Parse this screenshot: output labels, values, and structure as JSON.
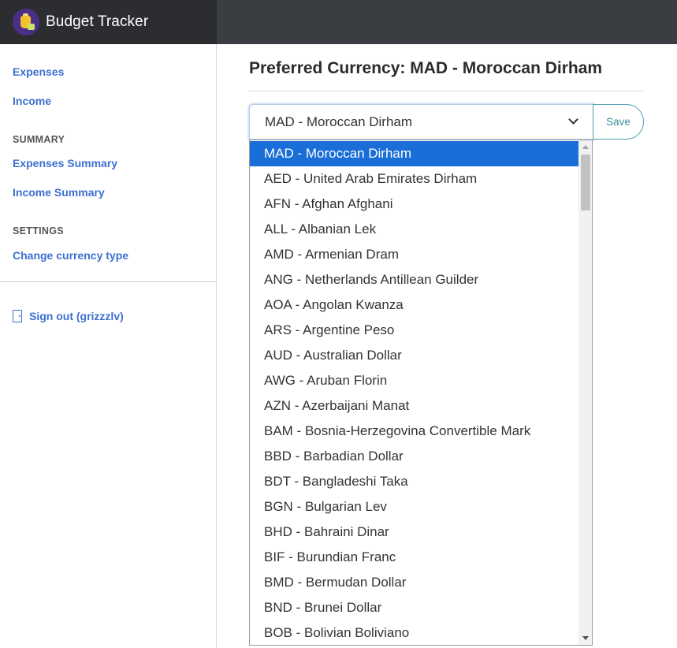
{
  "app": {
    "title": "Budget Tracker",
    "logo_icon": "money-bag-icon"
  },
  "sidebar": {
    "links": [
      {
        "label": "Expenses"
      },
      {
        "label": "Income"
      }
    ],
    "summary_heading": "SUMMARY",
    "summary_links": [
      {
        "label": "Expenses Summary"
      },
      {
        "label": "Income Summary"
      }
    ],
    "settings_heading": "SETTINGS",
    "settings_links": [
      {
        "label": "Change currency type"
      }
    ],
    "signout_label": "Sign out (grizzzlv)",
    "signout_icon": "door-icon"
  },
  "main": {
    "title": "Preferred Currency: MAD - Moroccan Dirham",
    "select_value": "MAD - Moroccan Dirham",
    "save_label": "Save"
  },
  "dropdown": {
    "selected_index": 0,
    "options": [
      "MAD - Moroccan Dirham",
      "AED - United Arab Emirates Dirham",
      "AFN - Afghan Afghani",
      "ALL - Albanian Lek",
      "AMD - Armenian Dram",
      "ANG - Netherlands Antillean Guilder",
      "AOA - Angolan Kwanza",
      "ARS - Argentine Peso",
      "AUD - Australian Dollar",
      "AWG - Aruban Florin",
      "AZN - Azerbaijani Manat",
      "BAM - Bosnia-Herzegovina Convertible Mark",
      "BBD - Barbadian Dollar",
      "BDT - Bangladeshi Taka",
      "BGN - Bulgarian Lev",
      "BHD - Bahraini Dinar",
      "BIF - Burundian Franc",
      "BMD - Bermudan Dollar",
      "BND - Brunei Dollar",
      "BOB - Bolivian Boliviano"
    ]
  },
  "colors": {
    "accent": "#1a6ed8",
    "link": "#3d6fd1",
    "save": "#3b8f9c",
    "topbar": "#2b2d31"
  }
}
